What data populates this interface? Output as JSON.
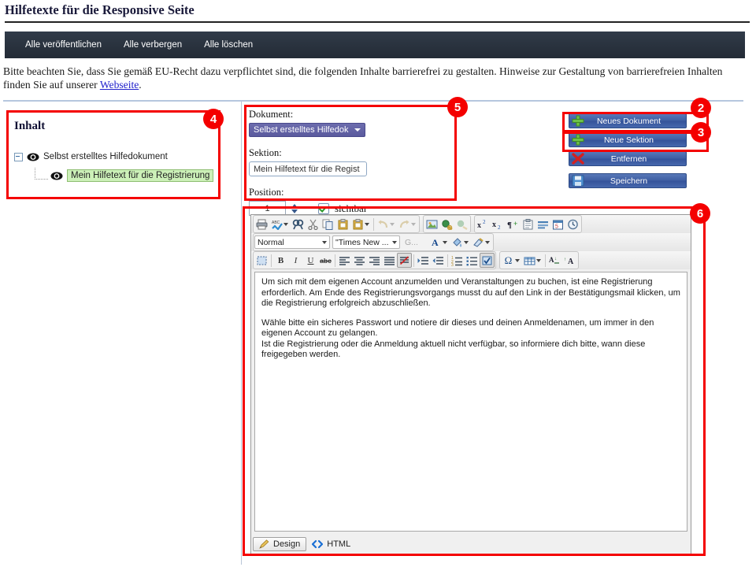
{
  "page": {
    "title": "Hilfetexte für die Responsive Seite"
  },
  "top_nav": {
    "items": [
      {
        "label": "Alle veröffentlichen",
        "name": "nav-publish-all"
      },
      {
        "label": "Alle verbergen",
        "name": "nav-hide-all"
      },
      {
        "label": "Alle löschen",
        "name": "nav-delete-all"
      }
    ]
  },
  "info": {
    "text_before": "Bitte beachten Sie, dass Sie gemäß EU-Recht dazu verpflichtet sind, die folgenden Inhalte barrierefrei zu gestalten. Hinweise zur Gestaltung von barrierefreien Inhalten finden Sie auf unserer ",
    "link": "Webseite",
    "text_after": "."
  },
  "tree_panel": {
    "title": "Inhalt",
    "nodes": [
      {
        "label": "Selbst erstelltes Hilfedokument",
        "level": 0,
        "selected": false
      },
      {
        "label": "Mein Hilfetext für die Registrierung",
        "level": 1,
        "selected": true
      }
    ]
  },
  "form": {
    "document_label": "Dokument:",
    "document_value": "Selbst erstelltes Hilfedok",
    "section_label": "Sektion:",
    "section_value": "Mein Hilfetext für die Regist",
    "position_label": "Position:",
    "position_value": "1",
    "visible_label": "sichtbar",
    "visible_checked": true
  },
  "actions": {
    "buttons": [
      {
        "label": "Neues Dokument",
        "icon": "plus-green-icon",
        "name": "new-document-button"
      },
      {
        "label": "Neue Sektion",
        "icon": "plus-green-icon",
        "name": "new-section-button"
      },
      {
        "label": "Entfernen",
        "icon": "x-red-icon",
        "name": "remove-button"
      },
      {
        "label": "Speichern",
        "icon": "save-disk-icon",
        "name": "save-button"
      }
    ]
  },
  "editor": {
    "toolbar_row1": [
      {
        "icon": "print-icon",
        "name": "print-button",
        "arrow": false
      },
      {
        "icon": "spellcheck-icon",
        "name": "spellcheck-button",
        "arrow": true
      },
      {
        "icon": "find-icon",
        "name": "find-button",
        "arrow": false
      },
      {
        "icon": "cut-icon",
        "name": "cut-button",
        "arrow": false
      },
      {
        "icon": "copy-icon",
        "name": "copy-button",
        "arrow": false
      },
      {
        "icon": "paste-icon",
        "name": "paste-button",
        "arrow": false
      },
      {
        "icon": "paste-special-icon",
        "name": "paste-special-button",
        "arrow": true
      },
      {
        "icon": "undo-icon",
        "name": "undo-button",
        "arrow": true,
        "disabled": true
      },
      {
        "icon": "redo-icon",
        "name": "redo-button",
        "arrow": true,
        "disabled": true
      }
    ],
    "toolbar_row1b": [
      {
        "icon": "image-icon",
        "name": "insert-image-button"
      },
      {
        "icon": "link-icon",
        "name": "insert-link-button"
      },
      {
        "icon": "unlink-icon",
        "name": "remove-link-button",
        "disabled": true
      }
    ],
    "toolbar_row1c": [
      {
        "icon": "superscript-icon",
        "name": "superscript-button"
      },
      {
        "icon": "subscript-icon",
        "name": "subscript-button"
      },
      {
        "icon": "pilcrow-icon",
        "name": "insert-paragraph-button"
      },
      {
        "icon": "clipboard-icon",
        "name": "clipboard-button"
      },
      {
        "icon": "horizontal-rule-icon",
        "name": "horizontal-rule-button"
      },
      {
        "icon": "calendar-icon",
        "name": "insert-date-button"
      },
      {
        "icon": "clock-icon",
        "name": "insert-time-button"
      }
    ],
    "style_select": "Normal",
    "font_select": "\"Times New ...",
    "size_select": "G...",
    "toolbar_row2_right": [
      {
        "icon": "font-color-icon",
        "name": "font-color-button",
        "arrow": true
      },
      {
        "icon": "highlight-color-icon",
        "name": "highlight-color-button",
        "arrow": true
      },
      {
        "icon": "format-painter-icon",
        "name": "format-painter-button",
        "arrow": true
      }
    ],
    "toolbar_row3": [
      {
        "icon": "select-all-icon",
        "name": "select-all-button"
      },
      {
        "icon": "bold-icon",
        "name": "bold-button",
        "glyph": "B"
      },
      {
        "icon": "italic-icon",
        "name": "italic-button",
        "glyph": "I"
      },
      {
        "icon": "underline-icon",
        "name": "underline-button",
        "glyph": "U"
      },
      {
        "icon": "strikethrough-icon",
        "name": "strikethrough-button",
        "glyph": "abc"
      },
      {
        "icon": "align-left-icon",
        "name": "align-left-button"
      },
      {
        "icon": "align-center-icon",
        "name": "align-center-button"
      },
      {
        "icon": "align-right-icon",
        "name": "align-right-button"
      },
      {
        "icon": "align-justify-icon",
        "name": "align-justify-button"
      },
      {
        "icon": "remove-format-icon",
        "name": "remove-format-button",
        "active": true
      },
      {
        "icon": "indent-increase-icon",
        "name": "indent-increase-button"
      },
      {
        "icon": "indent-decrease-icon",
        "name": "indent-decrease-button"
      },
      {
        "icon": "ordered-list-icon",
        "name": "ordered-list-button"
      },
      {
        "icon": "unordered-list-icon",
        "name": "unordered-list-button"
      },
      {
        "icon": "form-checkbox-icon",
        "name": "form-checkbox-button",
        "active": true
      },
      {
        "icon": "special-character-icon",
        "name": "special-character-button",
        "glyph": "Ω",
        "arrow": true
      },
      {
        "icon": "table-icon",
        "name": "insert-table-button",
        "arrow": true
      },
      {
        "icon": "decrease-font-icon",
        "name": "decrease-font-button"
      },
      {
        "icon": "increase-font-icon",
        "name": "increase-font-button"
      }
    ],
    "content_paragraphs": [
      "Um sich mit dem eigenen Account anzumelden und Veranstaltungen zu buchen, ist eine Registrierung erforderlich. Am Ende des Registrierungsvorgangs musst du auf den Link in der Bestätigungsmail klicken, um die Registrierung erfolgreich abzuschließen.",
      "Wähle bitte ein sicheres Passwort und notiere dir dieses und deinen Anmeldenamen, um immer in den eigenen Account zu gelangen.",
      "Ist die Registrierung oder die Anmeldung aktuell nicht verfügbar, so informiere dich bitte, wann diese freigegeben werden."
    ],
    "tabs": [
      {
        "label": "Design",
        "icon": "pencil-icon",
        "active": true
      },
      {
        "label": "HTML",
        "icon": "code-brackets-icon",
        "active": false
      }
    ]
  },
  "callouts": {
    "accent_color": "#f40000",
    "badges": [
      {
        "number": "2",
        "name": "callout-badge-2"
      },
      {
        "number": "3",
        "name": "callout-badge-3"
      },
      {
        "number": "4",
        "name": "callout-badge-4"
      },
      {
        "number": "5",
        "name": "callout-badge-5"
      },
      {
        "number": "6",
        "name": "callout-badge-6"
      }
    ]
  }
}
